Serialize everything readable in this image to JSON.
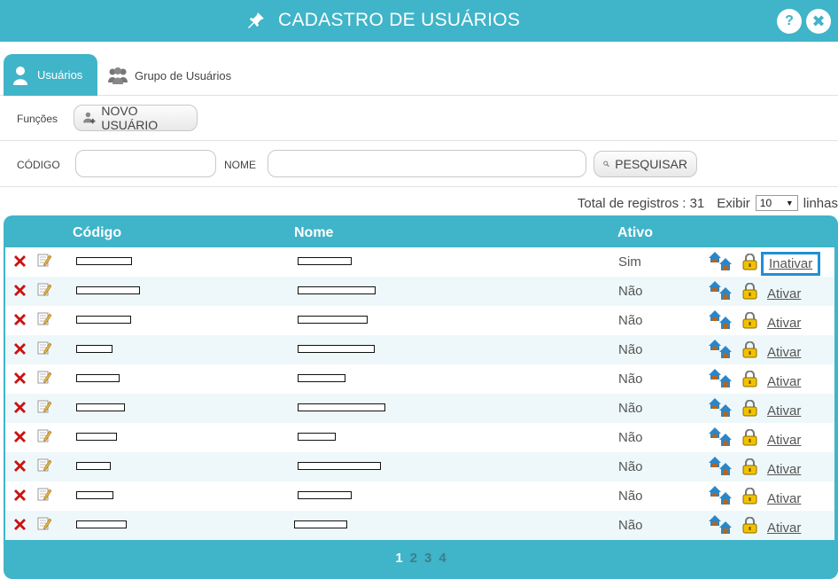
{
  "window": {
    "title": "CADASTRO DE USUÁRIOS",
    "help_label": "?",
    "close_label": "✖"
  },
  "tabs": [
    {
      "label": "Usuários",
      "active": true
    },
    {
      "label": "Grupo de Usuários",
      "active": false
    }
  ],
  "functions": {
    "label": "Funções",
    "new_user_label": "NOVO USUÁRIO"
  },
  "search": {
    "code_label": "CÓDIGO",
    "code_value": "",
    "name_label": "NOME",
    "name_value": "",
    "search_label": "PESQUISAR"
  },
  "paging_info": {
    "total_text": "Total de registros : 31",
    "show_label": "Exibir",
    "per_page": "10",
    "lines_label": "linhas"
  },
  "grid": {
    "headers": {
      "code": "Código",
      "name": "Nome",
      "active": "Ativo"
    },
    "rows": [
      {
        "active": "Sim",
        "action": "Inativar"
      },
      {
        "active": "Não",
        "action": "Ativar"
      },
      {
        "active": "Não",
        "action": "Ativar"
      },
      {
        "active": "Não",
        "action": "Ativar"
      },
      {
        "active": "Não",
        "action": "Ativar"
      },
      {
        "active": "Não",
        "action": "Ativar"
      },
      {
        "active": "Não",
        "action": "Ativar"
      },
      {
        "active": "Não",
        "action": "Ativar"
      },
      {
        "active": "Não",
        "action": "Ativar"
      },
      {
        "active": "Não",
        "action": "Ativar"
      }
    ]
  },
  "pagination": {
    "pages": [
      "1",
      "2",
      "3",
      "4"
    ],
    "current": "1"
  },
  "colors": {
    "accent": "#40b4c8",
    "delete": "#cc1111",
    "focus_border": "#1e90d6"
  }
}
